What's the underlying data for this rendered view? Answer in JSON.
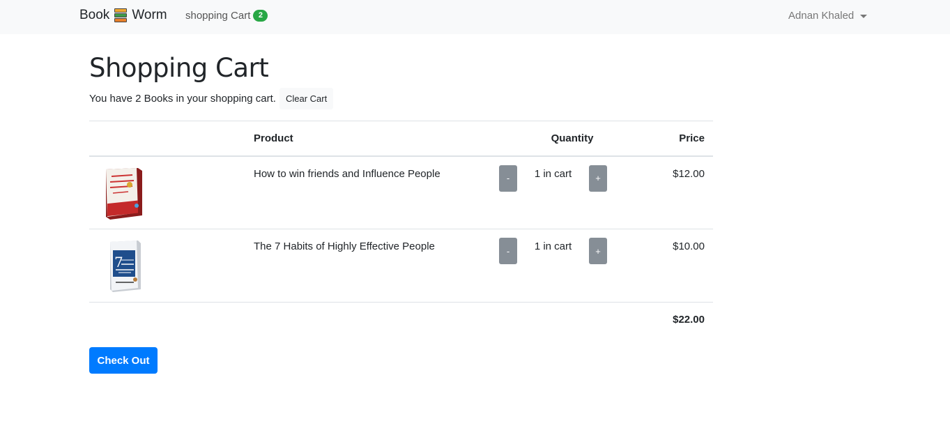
{
  "navbar": {
    "brand_left": "Book",
    "brand_right": "Worm",
    "brand_icon": "books-icon",
    "cart_link": "shopping Cart",
    "cart_count": "2",
    "user_name": "Adnan Khaled"
  },
  "page": {
    "title": "Shopping Cart",
    "summary": "You have 2 Books in your shopping cart.",
    "clear_cart": "Clear Cart"
  },
  "table": {
    "headers": {
      "image": "",
      "product": "Product",
      "quantity": "Quantity",
      "price": "Price"
    },
    "items": [
      {
        "name": "How to win friends and Influence People",
        "quantity": "1 in cart",
        "price": "$12.00",
        "decrease": "-",
        "increase": "+"
      },
      {
        "name": "The 7 Habits of Highly Effective People",
        "quantity": "1 in cart",
        "price": "$10.00",
        "decrease": "-",
        "increase": "+"
      }
    ],
    "total": "$22.00"
  },
  "checkout": {
    "label": "Check Out"
  },
  "colors": {
    "primary": "#007bff",
    "badge": "#28a745",
    "qty_button": "#868e96",
    "navbar_bg": "#f8f9fa"
  }
}
